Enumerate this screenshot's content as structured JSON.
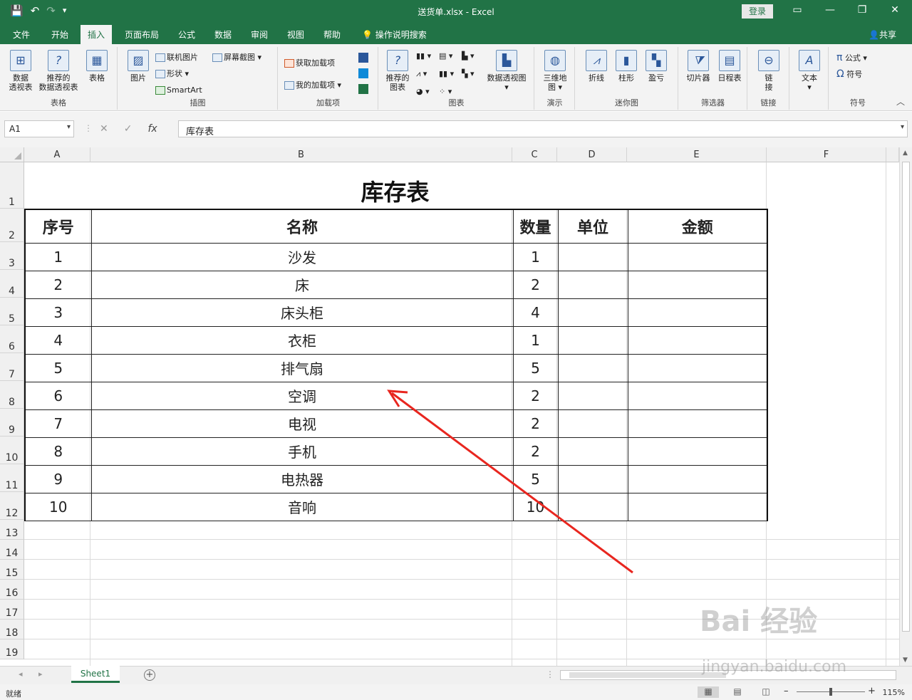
{
  "titlebar": {
    "doc_title": "送货单.xlsx  -  Excel",
    "login": "登录",
    "qat": [
      "💾",
      "↶",
      "↷",
      "▾"
    ]
  },
  "tabs": [
    "文件",
    "开始",
    "插入",
    "页面布局",
    "公式",
    "数据",
    "审阅",
    "视图",
    "帮助",
    "操作说明搜索"
  ],
  "share": "共享",
  "ribbon": {
    "groups": {
      "tables": {
        "label": "表格",
        "pivot": "数据\n透视表",
        "recommended_pivot": "推荐的\n数据透视表",
        "table": "表格"
      },
      "illustrations": {
        "label": "插图",
        "picture": "图片",
        "online_pictures": "联机图片",
        "shapes": "形状",
        "smartart": "SmartArt",
        "screenshot": "屏幕截图"
      },
      "addins": {
        "label": "加载项",
        "get_addins": "获取加载项",
        "my_addins": "我的加载项"
      },
      "charts": {
        "label": "图表",
        "recommended_charts": "推荐的\n图表",
        "pivot_chart": "数据透视图"
      },
      "tours": {
        "label": "演示",
        "map3d": "三维地\n图"
      },
      "sparklines": {
        "label": "迷你图",
        "line": "折线",
        "column": "柱形",
        "winloss": "盈亏"
      },
      "filters": {
        "label": "筛选器",
        "slicer": "切片器",
        "timeline": "日程表"
      },
      "links": {
        "label": "链接",
        "link": "链\n接"
      },
      "text": {
        "label": "",
        "text": "文本"
      },
      "symbols": {
        "label": "符号",
        "equation": "公式",
        "symbol": "符号"
      }
    }
  },
  "formula_bar": {
    "name_box": "A1",
    "formula": "库存表"
  },
  "columns": [
    "A",
    "B",
    "C",
    "D",
    "E",
    "F"
  ],
  "rows": [
    "1",
    "2",
    "3",
    "4",
    "5",
    "6",
    "7",
    "8",
    "9",
    "10",
    "11",
    "12",
    "13",
    "14",
    "15",
    "16",
    "17",
    "18",
    "19"
  ],
  "sheet": {
    "title": "库存表",
    "headers": [
      "序号",
      "名称",
      "数量",
      "单位",
      "金额"
    ],
    "data": [
      [
        "1",
        "沙发",
        "1",
        "",
        ""
      ],
      [
        "2",
        "床",
        "2",
        "",
        ""
      ],
      [
        "3",
        "床头柜",
        "4",
        "",
        ""
      ],
      [
        "4",
        "衣柜",
        "1",
        "",
        ""
      ],
      [
        "5",
        "排气扇",
        "5",
        "",
        ""
      ],
      [
        "6",
        "空调",
        "2",
        "",
        ""
      ],
      [
        "7",
        "电视",
        "2",
        "",
        ""
      ],
      [
        "8",
        "手机",
        "2",
        "",
        ""
      ],
      [
        "9",
        "电热器",
        "5",
        "",
        ""
      ],
      [
        "10",
        "音响",
        "10",
        "",
        ""
      ]
    ]
  },
  "sheet_tabs": [
    "Sheet1"
  ],
  "status": {
    "ready": "就绪",
    "zoom": "115%"
  },
  "watermark": {
    "brand": "Bai 经验",
    "url": "jingyan.baidu.com"
  },
  "annotation_color": "#e8261f"
}
